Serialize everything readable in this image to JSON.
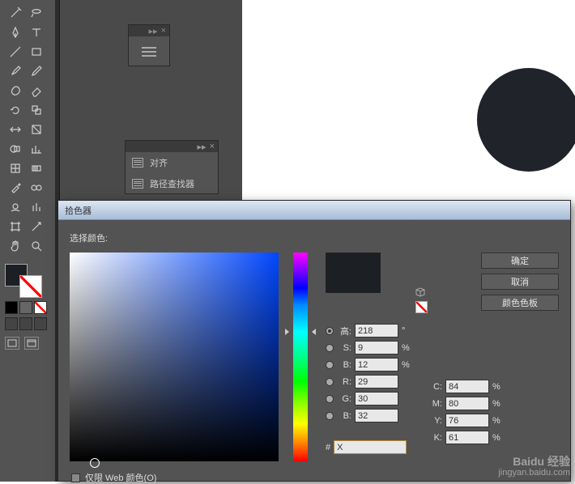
{
  "panel2": {
    "item1": "对齐",
    "item2": "路径查找器"
  },
  "dialog": {
    "title": "拾色器",
    "selectLabel": "选择颜色:",
    "ok": "确定",
    "cancel": "取消",
    "swatches": "颜色色板",
    "webOnly": "仅限 Web 颜色(O)",
    "hashLabel": "#",
    "hex": "X",
    "fields": {
      "H": {
        "label": "高:",
        "value": "218",
        "unit": "°"
      },
      "S": {
        "label": "S:",
        "value": "9",
        "unit": "%"
      },
      "Bv": {
        "label": "B:",
        "value": "12",
        "unit": "%"
      },
      "R": {
        "label": "R:",
        "value": "29"
      },
      "G": {
        "label": "G:",
        "value": "30"
      },
      "Bb": {
        "label": "B:",
        "value": "32"
      },
      "C": {
        "label": "C:",
        "value": "84",
        "unit": "%"
      },
      "M": {
        "label": "M:",
        "value": "80",
        "unit": "%"
      },
      "Y": {
        "label": "Y:",
        "value": "76",
        "unit": "%"
      },
      "K": {
        "label": "K:",
        "value": "61",
        "unit": "%"
      }
    }
  },
  "watermark": {
    "l1": "Baidu 经验",
    "l2": "jingyan.baidu.com"
  }
}
